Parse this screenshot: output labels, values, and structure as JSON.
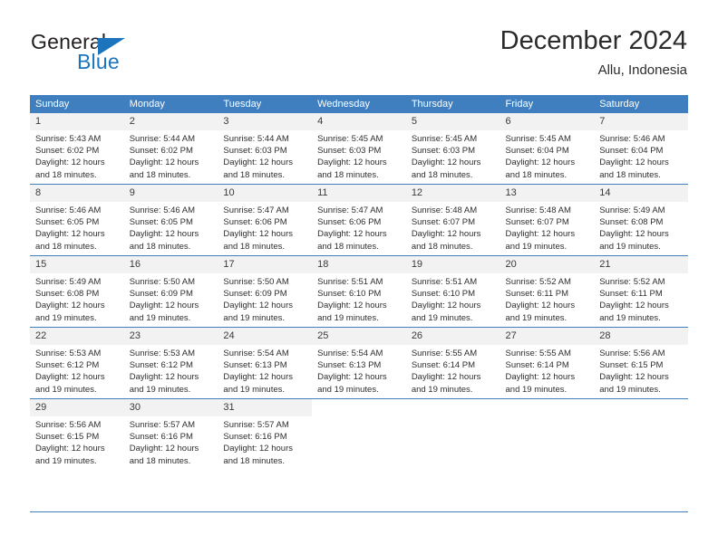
{
  "brand": {
    "name_top": "General",
    "name_bottom": "Blue",
    "triangle_color": "#1c75bc",
    "text_color": "#231f20",
    "accent_color": "#1c75bc",
    "logo_icon": "blue-triangle-icon"
  },
  "header": {
    "title": "December 2024",
    "subtitle": "Allu, Indonesia"
  },
  "calendar": {
    "header_bg": "#3f7fbf",
    "header_text_color": "#ffffff",
    "daynum_bg": "#f2f2f2",
    "weekdays": [
      "Sunday",
      "Monday",
      "Tuesday",
      "Wednesday",
      "Thursday",
      "Friday",
      "Saturday"
    ],
    "weeks": [
      [
        {
          "day": "1",
          "sunrise": "Sunrise: 5:43 AM",
          "sunset": "Sunset: 6:02 PM",
          "daylight1": "Daylight: 12 hours",
          "daylight2": "and 18 minutes."
        },
        {
          "day": "2",
          "sunrise": "Sunrise: 5:44 AM",
          "sunset": "Sunset: 6:02 PM",
          "daylight1": "Daylight: 12 hours",
          "daylight2": "and 18 minutes."
        },
        {
          "day": "3",
          "sunrise": "Sunrise: 5:44 AM",
          "sunset": "Sunset: 6:03 PM",
          "daylight1": "Daylight: 12 hours",
          "daylight2": "and 18 minutes."
        },
        {
          "day": "4",
          "sunrise": "Sunrise: 5:45 AM",
          "sunset": "Sunset: 6:03 PM",
          "daylight1": "Daylight: 12 hours",
          "daylight2": "and 18 minutes."
        },
        {
          "day": "5",
          "sunrise": "Sunrise: 5:45 AM",
          "sunset": "Sunset: 6:03 PM",
          "daylight1": "Daylight: 12 hours",
          "daylight2": "and 18 minutes."
        },
        {
          "day": "6",
          "sunrise": "Sunrise: 5:45 AM",
          "sunset": "Sunset: 6:04 PM",
          "daylight1": "Daylight: 12 hours",
          "daylight2": "and 18 minutes."
        },
        {
          "day": "7",
          "sunrise": "Sunrise: 5:46 AM",
          "sunset": "Sunset: 6:04 PM",
          "daylight1": "Daylight: 12 hours",
          "daylight2": "and 18 minutes."
        }
      ],
      [
        {
          "day": "8",
          "sunrise": "Sunrise: 5:46 AM",
          "sunset": "Sunset: 6:05 PM",
          "daylight1": "Daylight: 12 hours",
          "daylight2": "and 18 minutes."
        },
        {
          "day": "9",
          "sunrise": "Sunrise: 5:46 AM",
          "sunset": "Sunset: 6:05 PM",
          "daylight1": "Daylight: 12 hours",
          "daylight2": "and 18 minutes."
        },
        {
          "day": "10",
          "sunrise": "Sunrise: 5:47 AM",
          "sunset": "Sunset: 6:06 PM",
          "daylight1": "Daylight: 12 hours",
          "daylight2": "and 18 minutes."
        },
        {
          "day": "11",
          "sunrise": "Sunrise: 5:47 AM",
          "sunset": "Sunset: 6:06 PM",
          "daylight1": "Daylight: 12 hours",
          "daylight2": "and 18 minutes."
        },
        {
          "day": "12",
          "sunrise": "Sunrise: 5:48 AM",
          "sunset": "Sunset: 6:07 PM",
          "daylight1": "Daylight: 12 hours",
          "daylight2": "and 18 minutes."
        },
        {
          "day": "13",
          "sunrise": "Sunrise: 5:48 AM",
          "sunset": "Sunset: 6:07 PM",
          "daylight1": "Daylight: 12 hours",
          "daylight2": "and 19 minutes."
        },
        {
          "day": "14",
          "sunrise": "Sunrise: 5:49 AM",
          "sunset": "Sunset: 6:08 PM",
          "daylight1": "Daylight: 12 hours",
          "daylight2": "and 19 minutes."
        }
      ],
      [
        {
          "day": "15",
          "sunrise": "Sunrise: 5:49 AM",
          "sunset": "Sunset: 6:08 PM",
          "daylight1": "Daylight: 12 hours",
          "daylight2": "and 19 minutes."
        },
        {
          "day": "16",
          "sunrise": "Sunrise: 5:50 AM",
          "sunset": "Sunset: 6:09 PM",
          "daylight1": "Daylight: 12 hours",
          "daylight2": "and 19 minutes."
        },
        {
          "day": "17",
          "sunrise": "Sunrise: 5:50 AM",
          "sunset": "Sunset: 6:09 PM",
          "daylight1": "Daylight: 12 hours",
          "daylight2": "and 19 minutes."
        },
        {
          "day": "18",
          "sunrise": "Sunrise: 5:51 AM",
          "sunset": "Sunset: 6:10 PM",
          "daylight1": "Daylight: 12 hours",
          "daylight2": "and 19 minutes."
        },
        {
          "day": "19",
          "sunrise": "Sunrise: 5:51 AM",
          "sunset": "Sunset: 6:10 PM",
          "daylight1": "Daylight: 12 hours",
          "daylight2": "and 19 minutes."
        },
        {
          "day": "20",
          "sunrise": "Sunrise: 5:52 AM",
          "sunset": "Sunset: 6:11 PM",
          "daylight1": "Daylight: 12 hours",
          "daylight2": "and 19 minutes."
        },
        {
          "day": "21",
          "sunrise": "Sunrise: 5:52 AM",
          "sunset": "Sunset: 6:11 PM",
          "daylight1": "Daylight: 12 hours",
          "daylight2": "and 19 minutes."
        }
      ],
      [
        {
          "day": "22",
          "sunrise": "Sunrise: 5:53 AM",
          "sunset": "Sunset: 6:12 PM",
          "daylight1": "Daylight: 12 hours",
          "daylight2": "and 19 minutes."
        },
        {
          "day": "23",
          "sunrise": "Sunrise: 5:53 AM",
          "sunset": "Sunset: 6:12 PM",
          "daylight1": "Daylight: 12 hours",
          "daylight2": "and 19 minutes."
        },
        {
          "day": "24",
          "sunrise": "Sunrise: 5:54 AM",
          "sunset": "Sunset: 6:13 PM",
          "daylight1": "Daylight: 12 hours",
          "daylight2": "and 19 minutes."
        },
        {
          "day": "25",
          "sunrise": "Sunrise: 5:54 AM",
          "sunset": "Sunset: 6:13 PM",
          "daylight1": "Daylight: 12 hours",
          "daylight2": "and 19 minutes."
        },
        {
          "day": "26",
          "sunrise": "Sunrise: 5:55 AM",
          "sunset": "Sunset: 6:14 PM",
          "daylight1": "Daylight: 12 hours",
          "daylight2": "and 19 minutes."
        },
        {
          "day": "27",
          "sunrise": "Sunrise: 5:55 AM",
          "sunset": "Sunset: 6:14 PM",
          "daylight1": "Daylight: 12 hours",
          "daylight2": "and 19 minutes."
        },
        {
          "day": "28",
          "sunrise": "Sunrise: 5:56 AM",
          "sunset": "Sunset: 6:15 PM",
          "daylight1": "Daylight: 12 hours",
          "daylight2": "and 19 minutes."
        }
      ],
      [
        {
          "day": "29",
          "sunrise": "Sunrise: 5:56 AM",
          "sunset": "Sunset: 6:15 PM",
          "daylight1": "Daylight: 12 hours",
          "daylight2": "and 19 minutes."
        },
        {
          "day": "30",
          "sunrise": "Sunrise: 5:57 AM",
          "sunset": "Sunset: 6:16 PM",
          "daylight1": "Daylight: 12 hours",
          "daylight2": "and 18 minutes."
        },
        {
          "day": "31",
          "sunrise": "Sunrise: 5:57 AM",
          "sunset": "Sunset: 6:16 PM",
          "daylight1": "Daylight: 12 hours",
          "daylight2": "and 18 minutes."
        },
        {
          "day": "",
          "sunrise": "",
          "sunset": "",
          "daylight1": "",
          "daylight2": ""
        },
        {
          "day": "",
          "sunrise": "",
          "sunset": "",
          "daylight1": "",
          "daylight2": ""
        },
        {
          "day": "",
          "sunrise": "",
          "sunset": "",
          "daylight1": "",
          "daylight2": ""
        },
        {
          "day": "",
          "sunrise": "",
          "sunset": "",
          "daylight1": "",
          "daylight2": ""
        }
      ]
    ]
  }
}
